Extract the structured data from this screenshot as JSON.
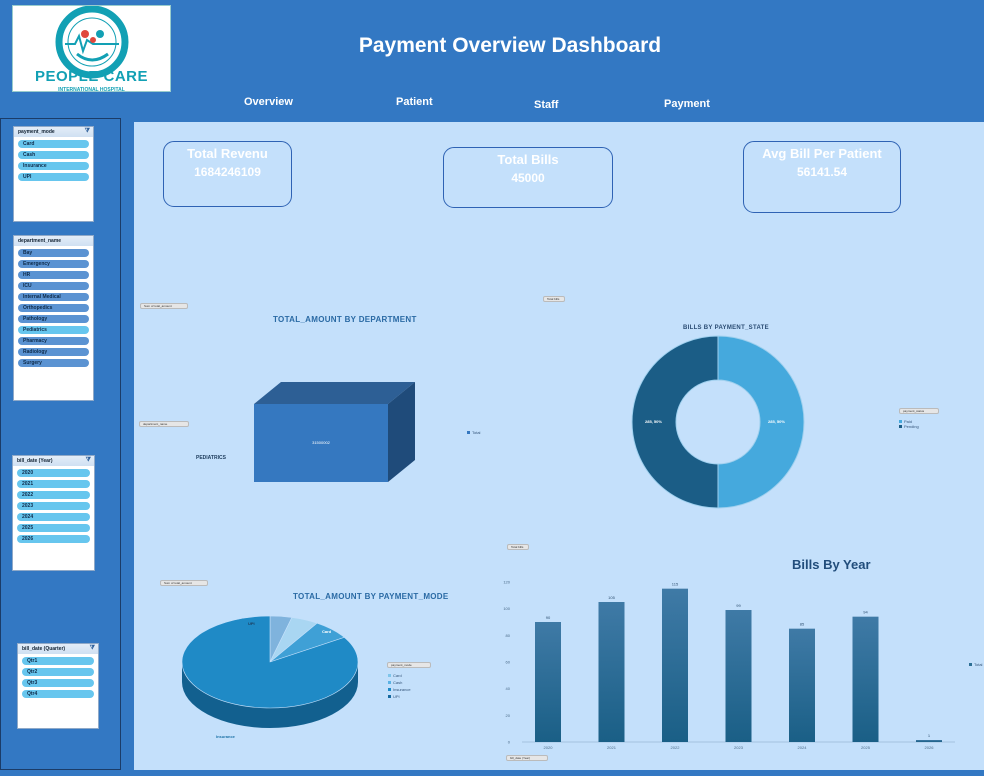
{
  "header": {
    "title": "Payment Overview Dashboard",
    "logo": {
      "name": "PEOPLE CARE",
      "ring_text": "PEOPLE CARE INTERNATIONAL HOSPITAL",
      "subtitle": "INTERNATIONAL HOSPITAL"
    },
    "nav": [
      "Overview",
      "Patient",
      "Staff",
      "Payment"
    ]
  },
  "slicers": {
    "payment_mode": {
      "title": "payment_mode",
      "items": [
        "Card",
        "Cash",
        "Insurance",
        "UPI"
      ]
    },
    "department": {
      "title": "department_name",
      "items": [
        "Bay",
        "Emergency",
        "HR",
        "ICU",
        "Internal Medical",
        "Orthopedics",
        "Pathology",
        "Pediatrics",
        "Pharmacy",
        "Radiology",
        "Surgery"
      ]
    },
    "year": {
      "title": "bill_date (Year)",
      "items": [
        "2020",
        "2021",
        "2022",
        "2023",
        "2024",
        "2025",
        "2026"
      ]
    },
    "quarter": {
      "title": "bill_date (Quarter)",
      "items": [
        "Qtr1",
        "Qtr2",
        "Qtr3",
        "Qtr4"
      ]
    }
  },
  "kpis": [
    {
      "label": "Total Revenu",
      "value": "1684246109"
    },
    {
      "label": "Total Bills",
      "value": "45000"
    },
    {
      "label": "Avg Bill Per Patient",
      "value": "56141.54"
    }
  ],
  "buttons": {
    "sum_total_amount_1": "Sum of total_amount",
    "department_filter": "department_name",
    "total_bills_1": "Total bills",
    "total_bills_2": "Total bills",
    "sum_total_amount_2": "Sum of total_amount",
    "payment_state_filter": "payment_status",
    "payment_mode_filter": "payment_mode",
    "bill_date_filter": "bill_date (Year)"
  },
  "colors": {
    "dark_blue": "#1b5d86",
    "light_blue": "#45a9dd",
    "bar_blue": "#2c6f94",
    "pie_blue": "#1f8ac6"
  },
  "chart_data": [
    {
      "type": "bar",
      "title": "TOTAL_AMOUNT BY DEPARTMENT",
      "categories": [
        "PEDIATRICS"
      ],
      "series": [
        {
          "name": "Total",
          "values": [
            31500002
          ]
        }
      ],
      "data_labels": [
        "31500002"
      ]
    },
    {
      "type": "pie",
      "title": "BILLS BY PAYMENT_STATE",
      "categories": [
        "Paid",
        "Pending"
      ],
      "values": [
        50,
        50
      ],
      "data_labels": [
        "285, 50%",
        "285, 50%"
      ],
      "legend_title": "payment_status",
      "legend_position": "right"
    },
    {
      "type": "pie",
      "title": "TOTAL_AMOUNT BY PAYMENT_MODE",
      "categories": [
        "UPI",
        "Card",
        "Cash",
        "Insurance"
      ],
      "values": [
        4,
        5,
        7,
        84
      ],
      "slice_labels": [
        "UPI",
        "Card",
        "",
        "Insurance"
      ],
      "legend_title": "payment_mode",
      "legend_position": "right"
    },
    {
      "type": "bar",
      "title": "Bills By Year",
      "categories": [
        "2020",
        "2021",
        "2022",
        "2023",
        "2024",
        "2025",
        "2026"
      ],
      "series": [
        {
          "name": "Total",
          "values": [
            90,
            105,
            115,
            99,
            85,
            94,
            1
          ]
        }
      ],
      "data_labels": [
        "90",
        "105",
        "115",
        "99",
        "85",
        "94",
        "1"
      ],
      "y_ticks": [
        "0",
        "20",
        "40",
        "60",
        "80",
        "100",
        "120"
      ],
      "ylim": [
        0,
        120
      ]
    }
  ]
}
